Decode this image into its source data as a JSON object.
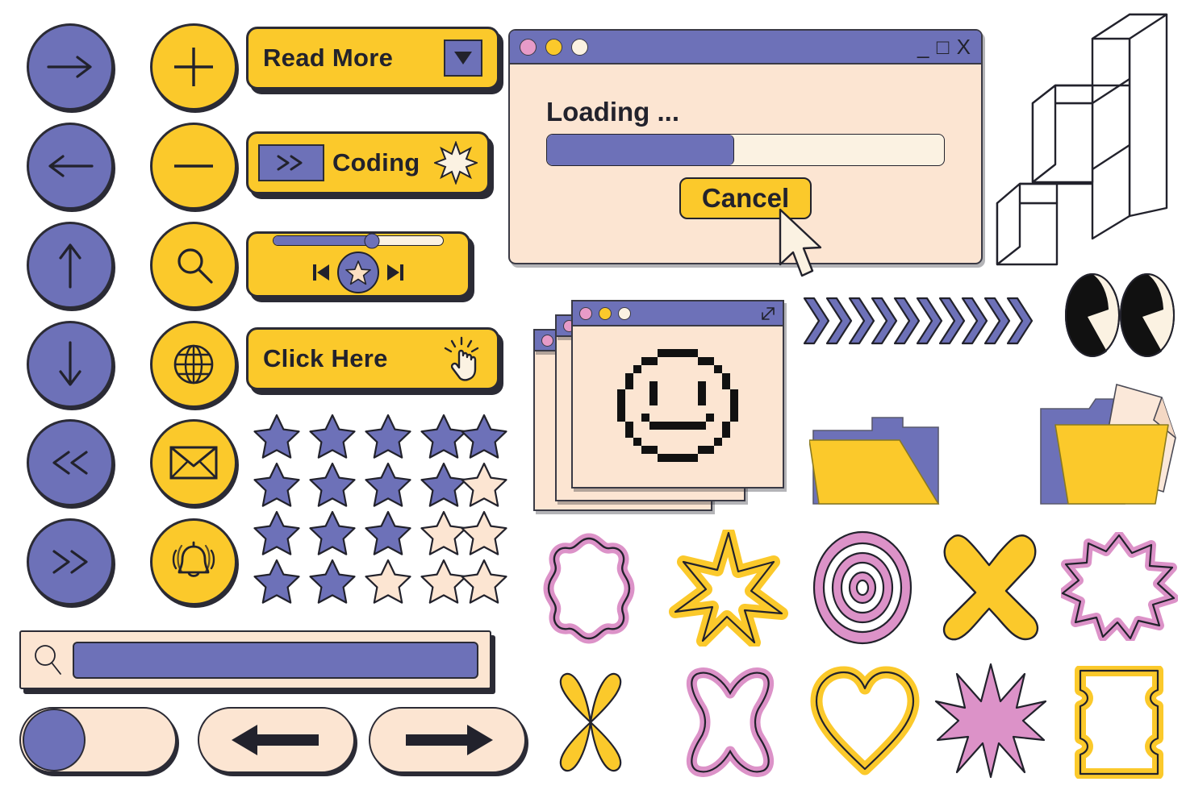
{
  "palette": {
    "purple": "#6D71B8",
    "yellow": "#FBC92B",
    "cream": "#FCE5D2",
    "pink": "#DC92C8",
    "ink": "#2b2b35",
    "white": "#FFFFFF"
  },
  "nav_circles": [
    {
      "name": "arrow-right",
      "color": "purple",
      "label": "Arrow Right"
    },
    {
      "name": "arrow-left",
      "color": "purple",
      "label": "Arrow Left"
    },
    {
      "name": "arrow-up",
      "color": "purple",
      "label": "Arrow Up"
    },
    {
      "name": "arrow-down",
      "color": "purple",
      "label": "Arrow Down"
    },
    {
      "name": "double-chevron-left",
      "color": "purple",
      "label": "Previous"
    },
    {
      "name": "double-chevron-right",
      "color": "purple",
      "label": "Next"
    }
  ],
  "action_circles": [
    {
      "name": "plus",
      "color": "yellow",
      "label": "Add"
    },
    {
      "name": "minus",
      "color": "yellow",
      "label": "Remove"
    },
    {
      "name": "search",
      "color": "yellow",
      "label": "Search"
    },
    {
      "name": "globe",
      "color": "yellow",
      "label": "Language"
    },
    {
      "name": "envelope",
      "color": "yellow",
      "label": "Mail"
    },
    {
      "name": "bell",
      "color": "yellow",
      "label": "Notifications"
    }
  ],
  "buttons": {
    "read_more": {
      "label": "Read More",
      "icon": "triangle-down-icon"
    },
    "coding": {
      "label": "Coding",
      "chip": ">>",
      "icon": "sparkle-burst-icon"
    },
    "media": {
      "slider_value": 62,
      "icons": [
        "skip-back-icon",
        "star-play-icon",
        "skip-forward-icon"
      ]
    },
    "click_here": {
      "label": "Click Here",
      "icon": "hand-pointer-icon"
    }
  },
  "loading_window": {
    "dots": [
      "pink",
      "yellow",
      "cream"
    ],
    "controls": "_ □ X",
    "title": "Loading ...",
    "progress_percent": 47,
    "cancel_label": "Cancel",
    "cursor": "arrow-cursor"
  },
  "smiley_window": {
    "dots": [
      "pink",
      "yellow",
      "cream"
    ],
    "resize_icon": "resize-diagonal-icon",
    "content": "pixel-smiley-face",
    "stack_count": 3
  },
  "stars": {
    "columns": 5,
    "rows": [
      {
        "filled": 5,
        "total": 5
      },
      {
        "filled": 4,
        "total": 5
      },
      {
        "filled": 3,
        "total": 5
      },
      {
        "filled": 2,
        "total": 5
      }
    ]
  },
  "search": {
    "icon": "magnifier-icon",
    "value": "",
    "placeholder": ""
  },
  "toggle": {
    "state": "off",
    "knob_position": "left"
  },
  "arrow_pills": [
    {
      "name": "arrow-left-pill",
      "label": "Back"
    },
    {
      "name": "arrow-right-pill",
      "label": "Forward"
    }
  ],
  "decor": {
    "cube_stack": {
      "name": "isometric-cube-staircase",
      "cubes": 6
    },
    "chevron_row": {
      "name": "chevron-arrow-row",
      "count": 10,
      "color": "purple"
    },
    "eyes": {
      "name": "cartoon-eyes",
      "count": 2
    },
    "folder_closed": {
      "name": "folder-icon"
    },
    "folder_open": {
      "name": "folder-open-document-icon"
    }
  },
  "stickers_row_1": [
    {
      "name": "flower-blob-sticker",
      "fill": "white",
      "stroke": "pink"
    },
    {
      "name": "six-point-star-sticker",
      "fill": "white",
      "stroke": "yellow"
    },
    {
      "name": "concentric-oval-sticker",
      "fill": "pink",
      "stroke": "pink"
    },
    {
      "name": "x-cross-sticker",
      "fill": "yellow",
      "stroke": "yellow"
    },
    {
      "name": "starburst-sticker",
      "fill": "white",
      "stroke": "pink"
    }
  ],
  "stickers_row_2": [
    {
      "name": "four-petal-sticker",
      "fill": "yellow",
      "stroke": "yellow"
    },
    {
      "name": "butterfly-blob-sticker",
      "fill": "pink",
      "stroke": "pink"
    },
    {
      "name": "heart-outline-sticker",
      "fill": "white",
      "stroke": "yellow"
    },
    {
      "name": "eight-point-star-sticker",
      "fill": "pink",
      "stroke": "pink"
    },
    {
      "name": "rounded-frame-sticker",
      "fill": "white",
      "stroke": "yellow"
    }
  ]
}
